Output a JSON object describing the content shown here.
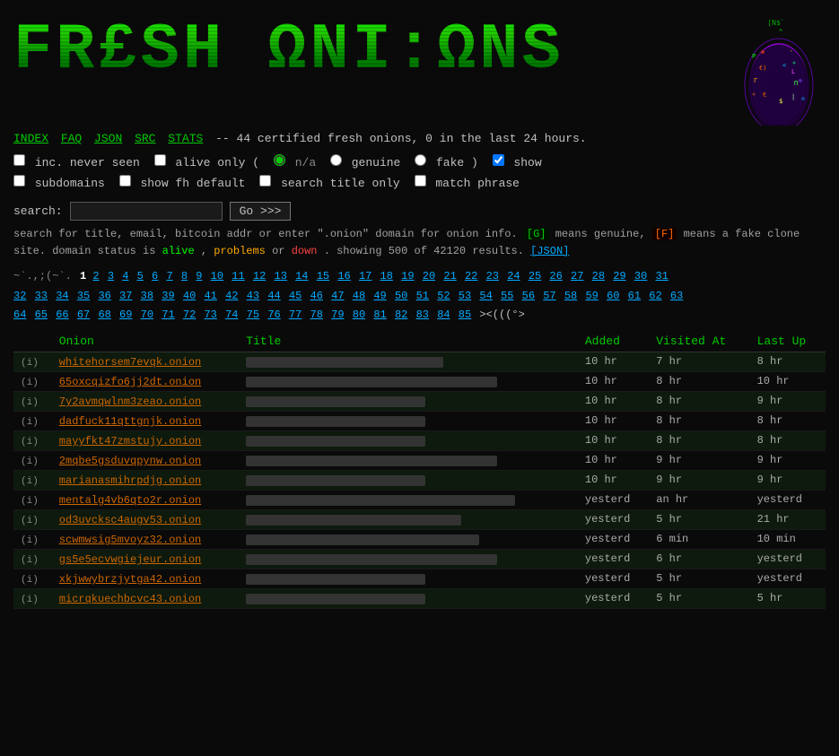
{
  "logo": {
    "text": "FR£SH ΩNI:ΩNS",
    "display": "FRESH ONIONS"
  },
  "nav": {
    "links": [
      "INDEX",
      "FAQ",
      "JSON",
      "SRC",
      "STATS"
    ],
    "info": "-- 44 certified fresh onions, 0 in the last 24 hours."
  },
  "options": {
    "inc_never_seen_label": "inc. never seen",
    "alive_only_label": "alive only (",
    "na_label": "n/a",
    "genuine_label": "genuine",
    "fake_label": "fake )",
    "show_label": "show",
    "subdomains_label": "subdomains",
    "show_fh_label": "show fh default",
    "search_title_label": "search title only",
    "match_phrase_label": "match phrase"
  },
  "search": {
    "label": "search:",
    "placeholder": "",
    "button": "Go >>>"
  },
  "help_text": {
    "line1": "search for title, email, bitcoin addr or enter \".onion\" domain for onion info.",
    "genuine_badge": "[G]",
    "genuine_desc": "means genuine,",
    "fake_badge": "[F]",
    "fake_desc": "means a fake clone site. domain status is",
    "alive": "alive",
    "problems": "problems",
    "or": "or",
    "down": "down",
    "showing": ". showing 500 of 42120 results.",
    "json_link": "[JSON]"
  },
  "pagination": {
    "dots_start": "~`.,;(~`.",
    "current": "1",
    "pages": [
      "2",
      "3",
      "4",
      "5",
      "6",
      "7",
      "8",
      "9",
      "10",
      "11",
      "12",
      "13",
      "14",
      "15",
      "16",
      "17",
      "18",
      "19",
      "20",
      "21",
      "22",
      "23",
      "24",
      "25",
      "26",
      "27",
      "28",
      "29",
      "30",
      "31",
      "32",
      "33",
      "34",
      "35",
      "36",
      "37",
      "38",
      "39",
      "40",
      "41",
      "42",
      "43",
      "44",
      "45",
      "46",
      "47",
      "48",
      "49",
      "50",
      "51",
      "52",
      "53",
      "54",
      "55",
      "56",
      "57",
      "58",
      "59",
      "60",
      "61",
      "62",
      "63",
      "64",
      "65",
      "66",
      "67",
      "68",
      "69",
      "70",
      "71",
      "72",
      "73",
      "74",
      "75",
      "76",
      "77",
      "78",
      "79",
      "80",
      "81",
      "82",
      "83",
      "84",
      "85"
    ],
    "end_symbol": "><(((°>"
  },
  "table": {
    "headers": [
      "",
      "Onion",
      "Title",
      "Added",
      "Visited At",
      "Last Up"
    ],
    "rows": [
      {
        "info": "(i)",
        "onion": "whitehorsem7evqk.onion",
        "title_blur": true,
        "added": "10 hr",
        "visited": "7 hr",
        "last_up": "8 hr"
      },
      {
        "info": "(i)",
        "onion": "65oxcqizfo6jj2dt.onion",
        "title_blur": true,
        "added": "10 hr",
        "visited": "8 hr",
        "last_up": "10 hr"
      },
      {
        "info": "(i)",
        "onion": "7y2avmqwlnm3zeao.onion",
        "title_blur": true,
        "added": "10 hr",
        "visited": "8 hr",
        "last_up": "9 hr"
      },
      {
        "info": "(i)",
        "onion": "dadfuck11qttgnjk.onion",
        "title_blur": true,
        "added": "10 hr",
        "visited": "8 hr",
        "last_up": "8 hr"
      },
      {
        "info": "(i)",
        "onion": "mayyfkt47zmstujy.onion",
        "title_blur": true,
        "added": "10 hr",
        "visited": "8 hr",
        "last_up": "8 hr"
      },
      {
        "info": "(i)",
        "onion": "2mqbe5gsduvqpynw.onion",
        "title_blur": true,
        "added": "10 hr",
        "visited": "9 hr",
        "last_up": "9 hr"
      },
      {
        "info": "(i)",
        "onion": "marianasmihrpdjg.onion",
        "title_blur": true,
        "added": "10 hr",
        "visited": "9 hr",
        "last_up": "9 hr"
      },
      {
        "info": "(i)",
        "onion": "mentalg4vb6qto2r.onion",
        "title_blur": true,
        "added": "yesterd",
        "visited": "an hr",
        "last_up": "yesterd"
      },
      {
        "info": "(i)",
        "onion": "od3uvcksc4augv53.onion",
        "title_blur": true,
        "added": "yesterd",
        "visited": "5 hr",
        "last_up": "21 hr"
      },
      {
        "info": "(i)",
        "onion": "scwmwsig5mvoyz32.onion",
        "title_blur": true,
        "added": "yesterd",
        "visited": "6 min",
        "last_up": "10 min"
      },
      {
        "info": "(i)",
        "onion": "gs5e5ecvwgiejeur.onion",
        "title_blur": true,
        "added": "yesterd",
        "visited": "6 hr",
        "last_up": "yesterd"
      },
      {
        "info": "(i)",
        "onion": "xkjwwybrzjytga42.onion",
        "title_blur": true,
        "added": "yesterd",
        "visited": "5 hr",
        "last_up": "yesterd"
      },
      {
        "info": "(i)",
        "onion": "micrqkuechbcvc43.onion",
        "title_blur": true,
        "added": "yesterd",
        "visited": "5 hr",
        "last_up": "5 hr"
      }
    ]
  },
  "colors": {
    "accent_green": "#00cc00",
    "onion_color": "#cc6600",
    "link_blue": "#00aaff",
    "alive_color": "#00ff00",
    "problems_color": "#ffaa00",
    "down_color": "#ff4444"
  }
}
